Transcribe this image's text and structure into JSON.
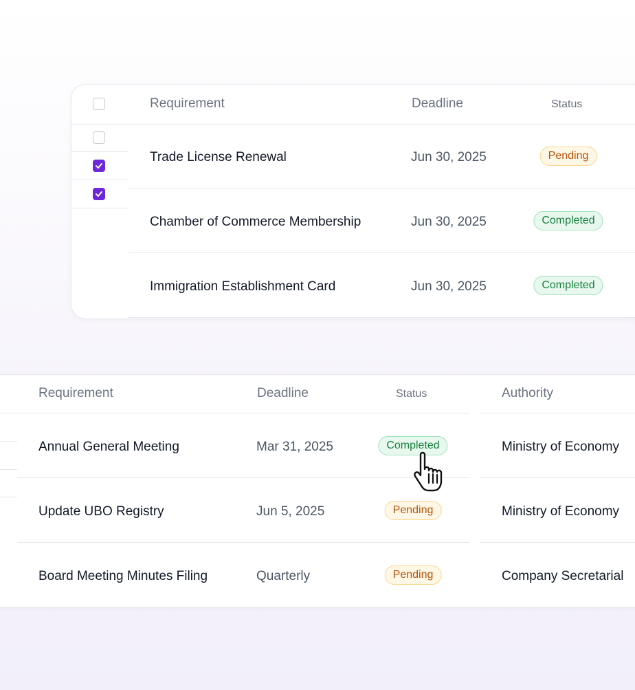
{
  "table_top": {
    "headers": {
      "requirement": "Requirement",
      "deadline": "Deadline",
      "status": "Status"
    },
    "checkboxes": [
      false,
      false,
      true,
      true
    ],
    "rows": [
      {
        "requirement": "Trade License Renewal",
        "deadline": "Jun 30, 2025",
        "status": "Pending",
        "status_kind": "pending"
      },
      {
        "requirement": "Chamber of Commerce Membership",
        "deadline": "Jun 30, 2025",
        "status": "Completed",
        "status_kind": "completed"
      },
      {
        "requirement": "Immigration Establishment Card",
        "deadline": "Jun 30, 2025",
        "status": "Completed",
        "status_kind": "completed"
      }
    ]
  },
  "table_bottom": {
    "headers": {
      "requirement": "Requirement",
      "deadline": "Deadline",
      "status": "Status",
      "authority": "Authority"
    },
    "rows": [
      {
        "requirement": "Annual General Meeting",
        "deadline": "Mar 31, 2025",
        "status": "Completed",
        "status_kind": "completed",
        "authority": "Ministry of Economy"
      },
      {
        "requirement": "Update UBO Registry",
        "deadline": "Jun 5, 2025",
        "status": "Pending",
        "status_kind": "pending",
        "authority": "Ministry of Economy"
      },
      {
        "requirement": "Board Meeting Minutes Filing",
        "deadline": "Quarterly",
        "status": "Pending",
        "status_kind": "pending",
        "authority": "Company Secretarial"
      }
    ]
  },
  "colors": {
    "accent": "#6d28d9",
    "pending_text": "#b45309",
    "completed_text": "#15803d"
  },
  "cursor_icon": "hand-pointer-icon"
}
